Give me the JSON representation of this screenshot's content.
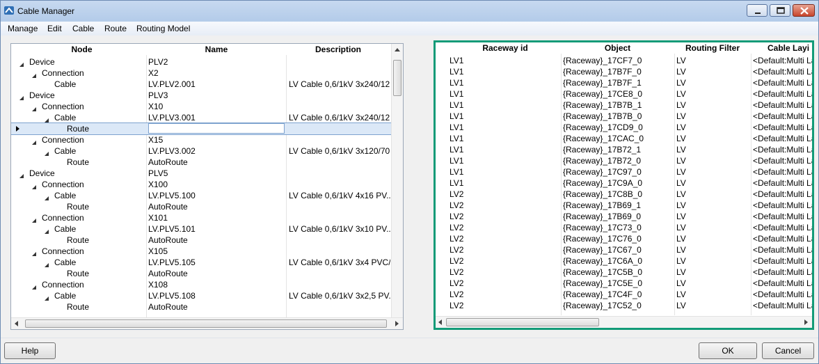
{
  "window": {
    "title": "Cable Manager"
  },
  "menu": [
    "Manage",
    "Edit",
    "Cable",
    "Route",
    "Routing Model"
  ],
  "tree": {
    "columns": [
      "Node",
      "Name",
      "Description"
    ],
    "rows": [
      {
        "node": "Device",
        "level": 0,
        "expanded": true,
        "name": "PLV2",
        "desc": ""
      },
      {
        "node": "Connection",
        "level": 1,
        "expanded": true,
        "name": "X2",
        "desc": ""
      },
      {
        "node": "Cable",
        "level": 2,
        "expanded": false,
        "name": "LV.PLV2.001",
        "desc": "LV Cable 0,6/1kV 3x240/12..."
      },
      {
        "node": "Device",
        "level": 0,
        "expanded": true,
        "name": "PLV3",
        "desc": ""
      },
      {
        "node": "Connection",
        "level": 1,
        "expanded": true,
        "name": "X10",
        "desc": ""
      },
      {
        "node": "Cable",
        "level": 2,
        "expanded": true,
        "name": "LV.PLV3.001",
        "desc": "LV Cable 0,6/1kV 3x240/12..."
      },
      {
        "node": "Route",
        "level": 3,
        "expanded": false,
        "name": "",
        "desc": "",
        "selected": true,
        "editing": true
      },
      {
        "node": "Connection",
        "level": 1,
        "expanded": true,
        "name": "X15",
        "desc": ""
      },
      {
        "node": "Cable",
        "level": 2,
        "expanded": true,
        "name": "LV.PLV3.002",
        "desc": "LV Cable 0,6/1kV 3x120/70..."
      },
      {
        "node": "Route",
        "level": 3,
        "expanded": false,
        "name": "AutoRoute",
        "desc": ""
      },
      {
        "node": "Device",
        "level": 0,
        "expanded": true,
        "name": "PLV5",
        "desc": ""
      },
      {
        "node": "Connection",
        "level": 1,
        "expanded": true,
        "name": "X100",
        "desc": ""
      },
      {
        "node": "Cable",
        "level": 2,
        "expanded": true,
        "name": "LV.PLV5.100",
        "desc": "LV Cable 0,6/1kV 4x16 PV..."
      },
      {
        "node": "Route",
        "level": 3,
        "expanded": false,
        "name": "AutoRoute",
        "desc": ""
      },
      {
        "node": "Connection",
        "level": 1,
        "expanded": true,
        "name": "X101",
        "desc": ""
      },
      {
        "node": "Cable",
        "level": 2,
        "expanded": true,
        "name": "LV.PLV5.101",
        "desc": "LV Cable 0,6/1kV 3x10 PV..."
      },
      {
        "node": "Route",
        "level": 3,
        "expanded": false,
        "name": "AutoRoute",
        "desc": ""
      },
      {
        "node": "Connection",
        "level": 1,
        "expanded": true,
        "name": "X105",
        "desc": ""
      },
      {
        "node": "Cable",
        "level": 2,
        "expanded": true,
        "name": "LV.PLV5.105",
        "desc": "LV Cable 0,6/1kV 3x4 PVC/..."
      },
      {
        "node": "Route",
        "level": 3,
        "expanded": false,
        "name": "AutoRoute",
        "desc": ""
      },
      {
        "node": "Connection",
        "level": 1,
        "expanded": true,
        "name": "X108",
        "desc": ""
      },
      {
        "node": "Cable",
        "level": 2,
        "expanded": true,
        "name": "LV.PLV5.108",
        "desc": "LV Cable 0,6/1kV 3x2,5 PV..."
      },
      {
        "node": "Route",
        "level": 3,
        "expanded": false,
        "name": "AutoRoute",
        "desc": ""
      }
    ]
  },
  "raceway": {
    "columns": [
      "Raceway id",
      "Object",
      "Routing Filter",
      "Cable Layi"
    ],
    "rows": [
      [
        "LV1",
        "{Raceway}_17CF7_0",
        "LV",
        "<Default:Multi La"
      ],
      [
        "LV1",
        "{Raceway}_17B7F_0",
        "LV",
        "<Default:Multi La"
      ],
      [
        "LV1",
        "{Raceway}_17B7F_1",
        "LV",
        "<Default:Multi La"
      ],
      [
        "LV1",
        "{Raceway}_17CE8_0",
        "LV",
        "<Default:Multi La"
      ],
      [
        "LV1",
        "{Raceway}_17B7B_1",
        "LV",
        "<Default:Multi La"
      ],
      [
        "LV1",
        "{Raceway}_17B7B_0",
        "LV",
        "<Default:Multi La"
      ],
      [
        "LV1",
        "{Raceway}_17CD9_0",
        "LV",
        "<Default:Multi La"
      ],
      [
        "LV1",
        "{Raceway}_17CAC_0",
        "LV",
        "<Default:Multi La"
      ],
      [
        "LV1",
        "{Raceway}_17B72_1",
        "LV",
        "<Default:Multi La"
      ],
      [
        "LV1",
        "{Raceway}_17B72_0",
        "LV",
        "<Default:Multi La"
      ],
      [
        "LV1",
        "{Raceway}_17C97_0",
        "LV",
        "<Default:Multi La"
      ],
      [
        "LV1",
        "{Raceway}_17C9A_0",
        "LV",
        "<Default:Multi La"
      ],
      [
        "LV2",
        "{Raceway}_17C8B_0",
        "LV",
        "<Default:Multi La"
      ],
      [
        "LV2",
        "{Raceway}_17B69_1",
        "LV",
        "<Default:Multi La"
      ],
      [
        "LV2",
        "{Raceway}_17B69_0",
        "LV",
        "<Default:Multi La"
      ],
      [
        "LV2",
        "{Raceway}_17C73_0",
        "LV",
        "<Default:Multi La"
      ],
      [
        "LV2",
        "{Raceway}_17C76_0",
        "LV",
        "<Default:Multi La"
      ],
      [
        "LV2",
        "{Raceway}_17C67_0",
        "LV",
        "<Default:Multi La"
      ],
      [
        "LV2",
        "{Raceway}_17C6A_0",
        "LV",
        "<Default:Multi La"
      ],
      [
        "LV2",
        "{Raceway}_17C5B_0",
        "LV",
        "<Default:Multi La"
      ],
      [
        "LV2",
        "{Raceway}_17C5E_0",
        "LV",
        "<Default:Multi La"
      ],
      [
        "LV2",
        "{Raceway}_17C4F_0",
        "LV",
        "<Default:Multi La"
      ],
      [
        "LV2",
        "{Raceway}_17C52_0",
        "LV",
        "<Default:Multi La"
      ]
    ]
  },
  "buttons": {
    "help": "Help",
    "ok": "OK",
    "cancel": "Cancel"
  },
  "colors": {
    "focus_frame": "#139b78",
    "selection": "#dbe8f7",
    "title_bar": "#b9cfeb"
  }
}
